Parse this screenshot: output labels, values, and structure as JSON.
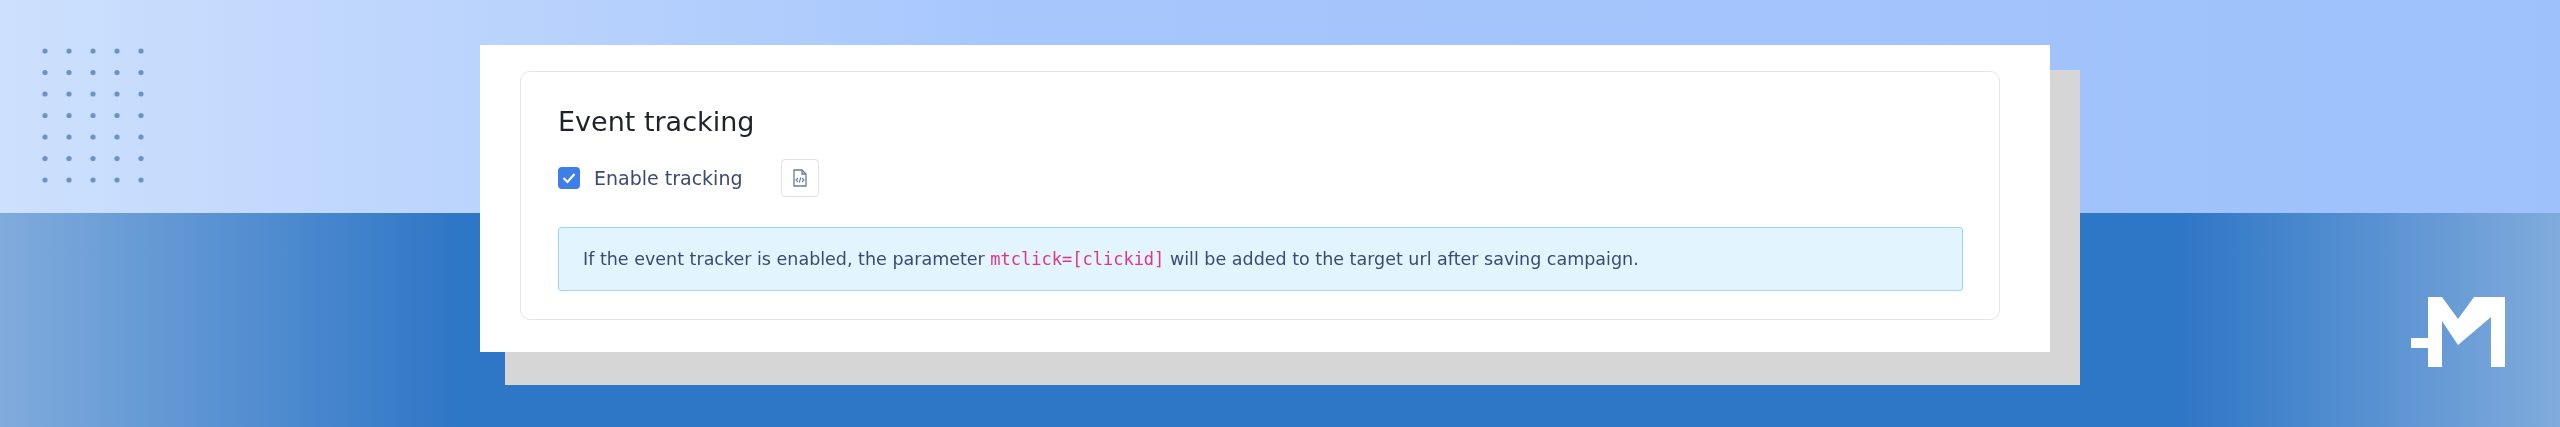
{
  "section": {
    "title": "Event tracking",
    "checkbox": {
      "label": "Enable tracking",
      "checked": true
    },
    "info": {
      "before": "If the event tracker is enabled, the parameter ",
      "code": "mtclick=[clickid]",
      "after": " will be added to the target url after saving campaign."
    }
  }
}
